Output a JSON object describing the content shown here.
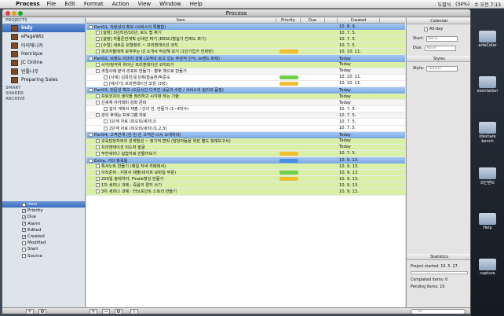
{
  "menubar": {
    "app": "Process",
    "items": [
      "File",
      "Edit",
      "Format",
      "Action",
      "View",
      "Window",
      "Help"
    ],
    "status": [
      "두벌식",
      "(34%)",
      "수 오전 7:13"
    ]
  },
  "window": {
    "title": "Process"
  },
  "sidebar": {
    "projects_header": "PROJECTS",
    "projects": [
      "Indy",
      "ePageWiz",
      "아이에니커",
      "Henrique",
      "JC Online",
      "빈틀나무",
      "Preparing Sales"
    ],
    "smart": "SMART",
    "shared": "SHARED",
    "archive": "ARCHIVE"
  },
  "columns": {
    "header": "Item",
    "items": [
      {
        "label": "Priority",
        "checked": true
      },
      {
        "label": "Due",
        "checked": true
      },
      {
        "label": "Alarm",
        "checked": true
      },
      {
        "label": "Edited",
        "checked": true
      },
      {
        "label": "Created",
        "checked": true
      },
      {
        "label": "Modified",
        "checked": false
      },
      {
        "label": "Start",
        "checked": false
      },
      {
        "label": "Source",
        "checked": false
      }
    ]
  },
  "table": {
    "headers": {
      "item": "Item",
      "priority": "Priority",
      "due": "Due",
      "created": "Created"
    },
    "rows": [
      {
        "text": "Part01, 자분성의 확보 (서비스의 특별함)",
        "type": "section",
        "created": "10. 8. 9."
      },
      {
        "text": "[설정] 3년/5년/10년, 로드 맵 짜기",
        "type": "task",
        "created": "10. 7. 5."
      },
      {
        "text": "[설정] 자율준전계획 상세안 짜기 (ERSC/형실기 컨퍼도 파기)",
        "type": "task",
        "created": "10. 7. 5."
      },
      {
        "text": "[수립] 새로운 모형정조 ~ 프리젠테이션 코치",
        "type": "task",
        "created": "10. 7. 5."
      },
      {
        "text": "피코지들에게 보여주는 내 소개서 작성해 보기 (1인기업가 컨퍼런)",
        "type": "task",
        "priority": "#f0c030",
        "created": "10. 10. 11."
      },
      {
        "text": "Part02, 브랜드 이미지 강화 (고객이 갖고 있는 주관적 인식, 브랜드 파워)",
        "type": "section",
        "created": "Today"
      },
      {
        "text": "시각/청각위 위이난 프리젠테이션 코치되기",
        "type": "task",
        "created": "Today"
      },
      {
        "text": "코칭사례 분석 리포트 만들기 : 향후 책으로 만들기",
        "type": "group",
        "created": "Today"
      },
      {
        "text": "[사례] 김목진/운성제/홍승환/박준숙",
        "type": "sub",
        "priority": "#6fcf4a",
        "created": "10. 10. 11."
      },
      {
        "text": "[제사기] 프리젠테이션 코칭 (3장)",
        "type": "sub",
        "priority": "#f0c030",
        "created": "10. 10. 11."
      },
      {
        "text": "Part03, 전문성 확보 (오픈시간 다져진 내공과 수련 / 서비스의 질이와 품질)",
        "type": "section",
        "created": "Today"
      },
      {
        "text": "프로코치의 생각을 정리하고 시각화 하는 기술",
        "type": "task",
        "created": "Today"
      },
      {
        "text": "신세계 아카데미 강좌 준비",
        "type": "group",
        "created": "Today"
      },
      {
        "text": "잡의 계획서 제출 / 강의 안, 만들기 (1~4차수)",
        "type": "sub",
        "created": "10. 7. 5."
      },
      {
        "text": "강의 후에는 프로그램 자료",
        "type": "group",
        "created": "10. 7. 5."
      },
      {
        "text": "1단계 자료 (피오피/세미나)",
        "type": "sub",
        "created": "10. 7. 5."
      },
      {
        "text": "2단계 자료 (피오피/세미나1,2,3)",
        "type": "sub",
        "created": "10. 7. 5."
      },
      {
        "text": "Part04, 고객관계 (한 번 온 고객은 다시 오게하라)",
        "type": "section",
        "created": "Today"
      },
      {
        "text": "교육담당자와의 관계형성 ~ 정기적 면락 (담당자들을 위한 별도 월례보고서)",
        "type": "task",
        "created": "Today"
      },
      {
        "text": "프리젠테이션 피드처 발굴",
        "type": "task",
        "created": "Today"
      },
      {
        "text": "무한세미나 실습자료 만들어보기",
        "type": "task",
        "priority": "#f0c030",
        "created": "10. 7. 5."
      },
      {
        "text": "Extra, 기타 항목들",
        "type": "section",
        "priority": "#4a90e0",
        "created": "10. 9. 13."
      },
      {
        "text": "특서노트 만들기 (매일 저녁 카페에서)",
        "type": "task",
        "created": "10. 9. 13."
      },
      {
        "text": "이직준비 : 지원서 제출(네이트 모바일 부문)",
        "type": "task",
        "priority": "#6fcf4a",
        "created": "10. 9. 13."
      },
      {
        "text": "200일 총력하자, Finale명성 만들기",
        "type": "task",
        "priority": "#f0c030",
        "created": "10. 9. 13."
      },
      {
        "text": "1차 세미나 과제 : 죽음의 편지 쓰기",
        "type": "task",
        "created": "10. 9. 13."
      },
      {
        "text": "3차 세미나 과제 : 터닝포인트 스토리 만들기",
        "type": "task",
        "created": "10. 9. 13."
      }
    ]
  },
  "calendar": {
    "title": "Calendar",
    "allday": "All-day",
    "start_label": "Start:",
    "start_value": "None",
    "due_label": "Due:",
    "due_value": "None"
  },
  "styles": {
    "title": "Styles",
    "style_label": "Style:",
    "style_value": "default"
  },
  "statistics": {
    "title": "Statistics",
    "project_started_label": "Project started:",
    "project_started": "10. 5. 27.",
    "completed_label": "Completed items:",
    "completed": "0",
    "pending_label": "Pending items:",
    "pending": "19"
  },
  "search": {
    "placeholder": "All"
  },
  "desktop": [
    "arteColor",
    "esentation",
    "ideshare bench",
    "외인벤트",
    "Help",
    "capture"
  ]
}
